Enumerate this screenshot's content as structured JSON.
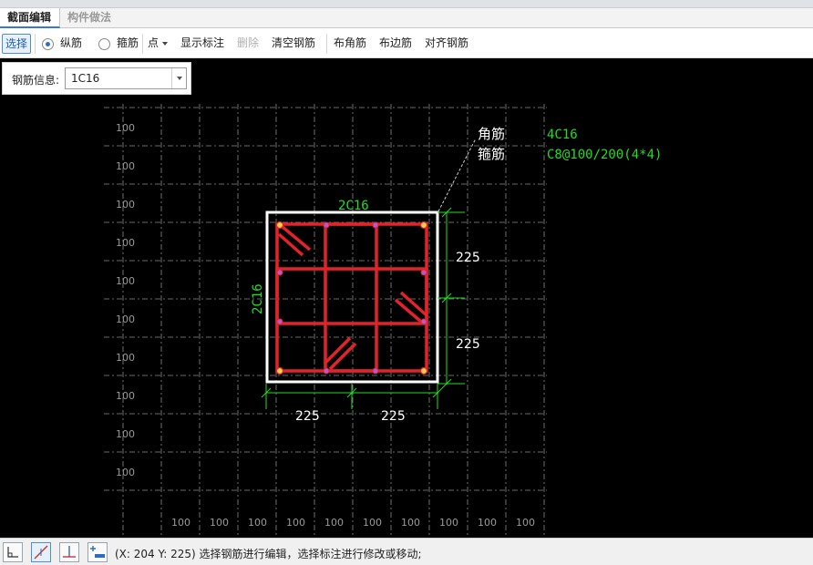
{
  "tabs": [
    {
      "label": "截面编辑",
      "active": true
    },
    {
      "label": "构件做法",
      "active": false
    }
  ],
  "toolbar": {
    "select": "选择",
    "radio_longitudinal": "纵筋",
    "radio_stirrup": "箍筋",
    "point": "点",
    "show_annotation": "显示标注",
    "delete": "删除",
    "clear_rebar": "清空钢筋",
    "place_corner": "布角筋",
    "place_edge": "布边筋",
    "align_rebar": "对齐钢筋"
  },
  "rebar_info": {
    "label": "钢筋信息:",
    "value": "1C16"
  },
  "drawing": {
    "grid_label": "100",
    "corner_label": "角筋",
    "corner_value": "4C16",
    "stirrup_label": "箍筋",
    "stirrup_value": "C8@100/200(4*4)",
    "top_edge": "2C16",
    "left_edge": "2C16",
    "dim_right_top": "225",
    "dim_right_bottom": "225",
    "dim_bottom_left": "225",
    "dim_bottom_right": "225"
  },
  "colors": {
    "section": "#ffffff",
    "rebar": "#e3222a",
    "dimension": "#22dd22",
    "label_green": "#22dd22",
    "grid": "#8a8a8a",
    "grid_text": "#9a9a9a"
  },
  "status": {
    "coords": "(X: 204 Y: 225)",
    "message": "选择钢筋进行编辑，选择标注进行修改或移动;"
  }
}
